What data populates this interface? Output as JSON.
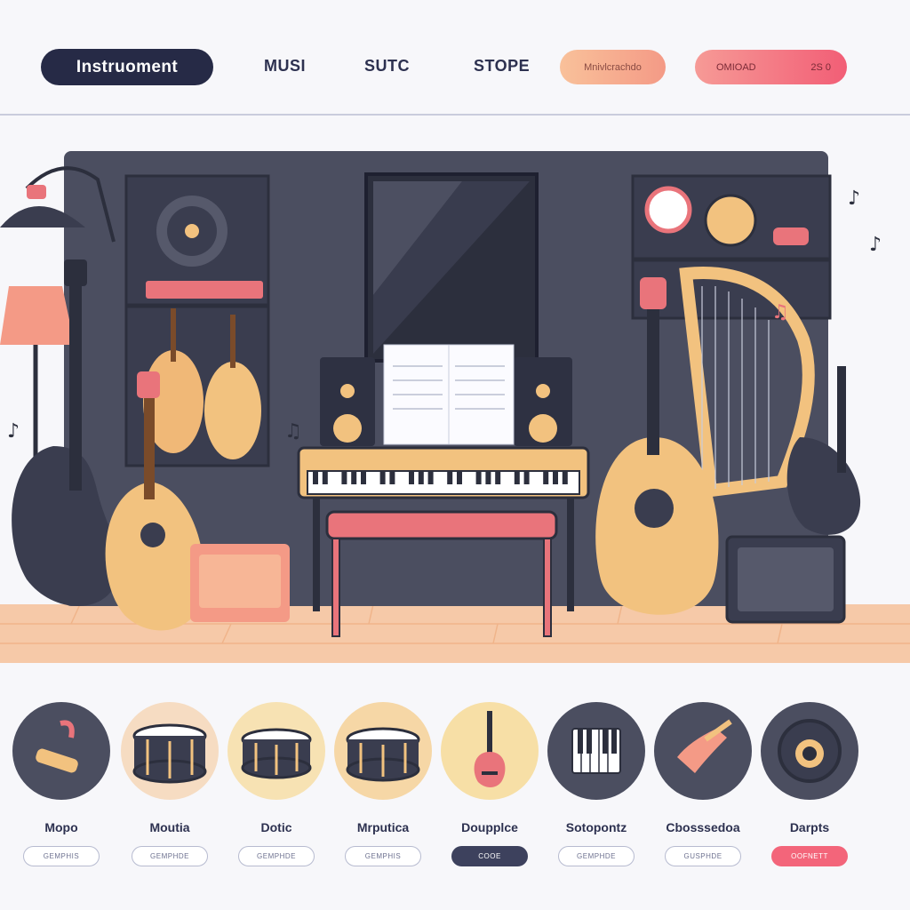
{
  "header": {
    "logo": "Instruoment",
    "nav": [
      "MUSI",
      "SUTC",
      "STOPE"
    ],
    "pill_a_label": "Mnivlcrachdo",
    "pill_b_label": "OMIOAD",
    "pill_b_value": "2S 0"
  },
  "categories": [
    {
      "label": "Mopo",
      "button": "GEMPHIS"
    },
    {
      "label": "Moutia",
      "button": "GEMPHDE"
    },
    {
      "label": "Dotic",
      "button": "GEMPHDE"
    },
    {
      "label": "Mrputica",
      "button": "GEMPHIS"
    },
    {
      "label": "Doupplce",
      "button": "COOE"
    },
    {
      "label": "Sotopontz",
      "button": "GEMPHDE"
    },
    {
      "label": "Cbosssedoa",
      "button": "GUSPHDE"
    },
    {
      "label": "Darpts",
      "button": "OOFNETT"
    }
  ],
  "colors": {
    "accent": "#f3657a",
    "navy": "#262a46",
    "wall": "#4b4e60",
    "wood": "#f2c27f"
  }
}
